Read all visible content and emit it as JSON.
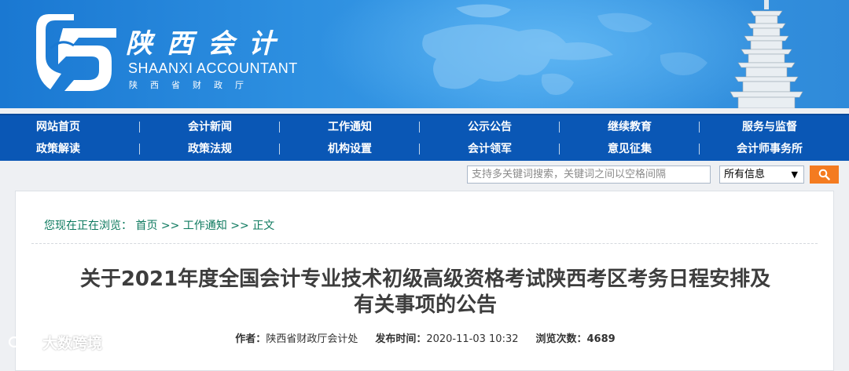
{
  "banner": {
    "logo_cn": "陕西会计",
    "logo_en": "SHAANXI ACCOUNTANT",
    "logo_sub": "陕西省财政厅"
  },
  "nav": {
    "row1": [
      "网站首页",
      "会计新闻",
      "工作通知",
      "公示公告",
      "继续教育",
      "服务与监督"
    ],
    "row2": [
      "政策解读",
      "政策法规",
      "机构设置",
      "会计领军",
      "意见征集",
      "会计师事务所"
    ]
  },
  "search": {
    "placeholder": "支持多关键词搜索，关键词之间以空格间隔",
    "scope_selected": "所有信息",
    "scope_arrow": "▼",
    "button_icon": "search-icon"
  },
  "breadcrumb": {
    "prefix": "您现在正在浏览：",
    "items": [
      "首页",
      "工作通知",
      "正文"
    ],
    "sep": ">>"
  },
  "article": {
    "title_line1": "关于2021年度全国会计专业技术初级高级资格考试陕西考区考务日程安排及",
    "title_line2": "有关事项的公告",
    "author_label": "作者：",
    "author": "陕西省财政厅会计处",
    "date_label": "发布时间：",
    "date": "2020-11-03 10:32",
    "views_label": "浏览次数：",
    "views": "4689"
  },
  "watermark": {
    "text": "大数跨境"
  },
  "colors": {
    "nav_bg": "#0a57b5",
    "accent_orange": "#f47b20",
    "breadcrumb_green": "#0e7a5f"
  }
}
